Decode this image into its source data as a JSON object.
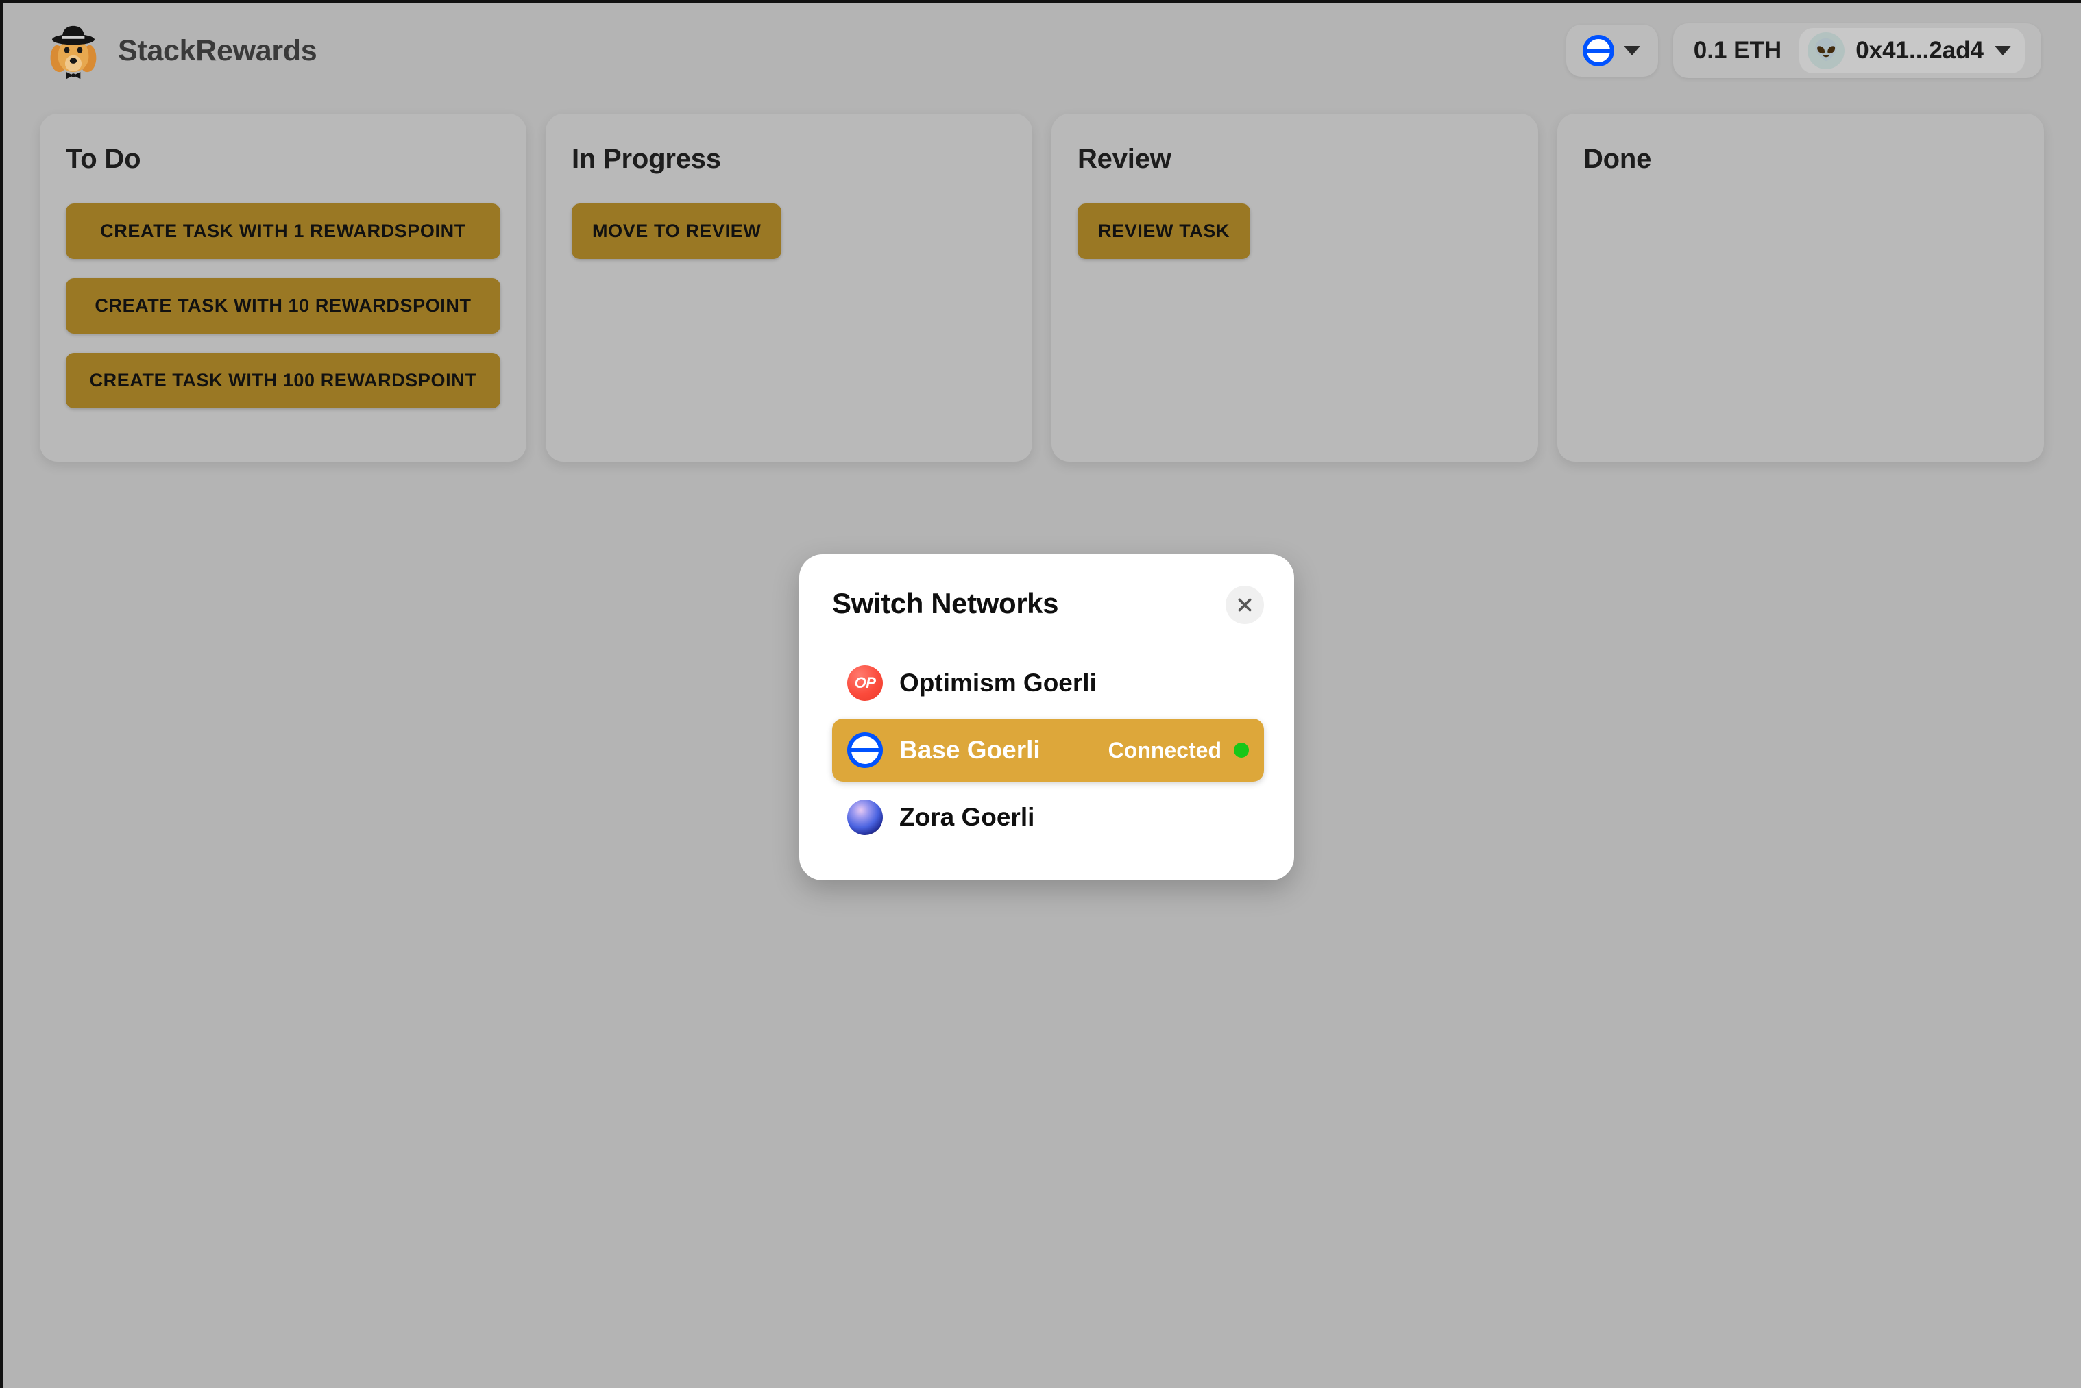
{
  "app": {
    "brand_name": "StackRewards",
    "logo_icon": "dog-with-hat-logo"
  },
  "header": {
    "network_chip": {
      "icon": "base-network-icon",
      "chevron_icon": "chevron-down-icon"
    },
    "account_chip": {
      "balance": "0.1 ETH",
      "avatar_icon": "alien-avatar",
      "address": "0x41...2ad4",
      "chevron_icon": "chevron-down-icon"
    }
  },
  "board": {
    "columns": [
      {
        "title": "To Do",
        "buttons": [
          "CREATE TASK WITH 1 REWARDSPOINT",
          "CREATE TASK WITH 10 REWARDSPOINT",
          "CREATE TASK WITH 100 REWARDSPOINT"
        ]
      },
      {
        "title": "In Progress",
        "buttons": [
          "MOVE TO REVIEW"
        ]
      },
      {
        "title": "Review",
        "buttons": [
          "REVIEW TASK"
        ]
      },
      {
        "title": "Done",
        "buttons": []
      }
    ]
  },
  "modal": {
    "title": "Switch Networks",
    "close_icon": "close-icon",
    "networks": [
      {
        "name": "Optimism Goerli",
        "icon": "optimism-icon",
        "status": "",
        "selected": false
      },
      {
        "name": "Base Goerli",
        "icon": "base-icon",
        "status": "Connected",
        "selected": true
      },
      {
        "name": "Zora Goerli",
        "icon": "zora-icon",
        "status": "",
        "selected": false
      }
    ]
  },
  "colors": {
    "page_background": "#b4b4b4",
    "column_background": "#b9b9b9",
    "button": "#9a7824",
    "accent_selected": "#dda73a",
    "status_dot": "#18c718",
    "base_blue": "#0052ff",
    "optimism_red": "#fb4b3c"
  }
}
